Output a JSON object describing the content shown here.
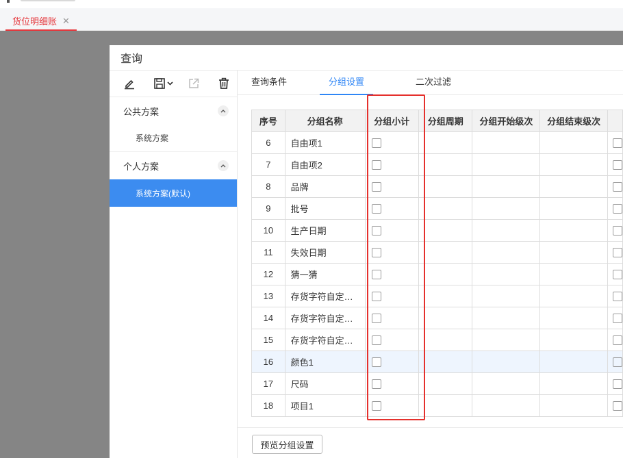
{
  "document_tab": {
    "title": "货位明细账",
    "close": "✕"
  },
  "dialog": {
    "title": "查询",
    "toolbar": {
      "edit": "edit-icon",
      "save": "save-icon",
      "export": "export-icon",
      "delete": "trash-icon"
    },
    "sections": [
      {
        "title": "公共方案",
        "items": [
          "系统方案"
        ]
      },
      {
        "title": "个人方案",
        "items": [
          "系统方案(默认)"
        ]
      }
    ],
    "tabs": [
      "查询条件",
      "分组设置",
      "二次过滤"
    ],
    "active_tab": "分组设置",
    "table": {
      "columns": [
        "序号",
        "分组名称",
        "分组小计",
        "分组周期",
        "分组开始级次",
        "分组结束级次"
      ],
      "rows": [
        {
          "no": "6",
          "name": "自由项1"
        },
        {
          "no": "7",
          "name": "自由项2"
        },
        {
          "no": "8",
          "name": "品牌"
        },
        {
          "no": "9",
          "name": "批号"
        },
        {
          "no": "10",
          "name": "生产日期"
        },
        {
          "no": "11",
          "name": "失效日期"
        },
        {
          "no": "12",
          "name": "猜一猜"
        },
        {
          "no": "13",
          "name": "存货字符自定…"
        },
        {
          "no": "14",
          "name": "存货字符自定…"
        },
        {
          "no": "15",
          "name": "存货字符自定…"
        },
        {
          "no": "16",
          "name": "颜色1"
        },
        {
          "no": "17",
          "name": "尺码"
        },
        {
          "no": "18",
          "name": "项目1"
        }
      ],
      "highlighted_row": "16"
    },
    "preview_button": "预览分组设置"
  },
  "colors": {
    "accent": "#2f86f6",
    "active_plan": "#3c8cf0",
    "doc_tab": "#e5363b",
    "highlight_box": "#e5302c"
  }
}
